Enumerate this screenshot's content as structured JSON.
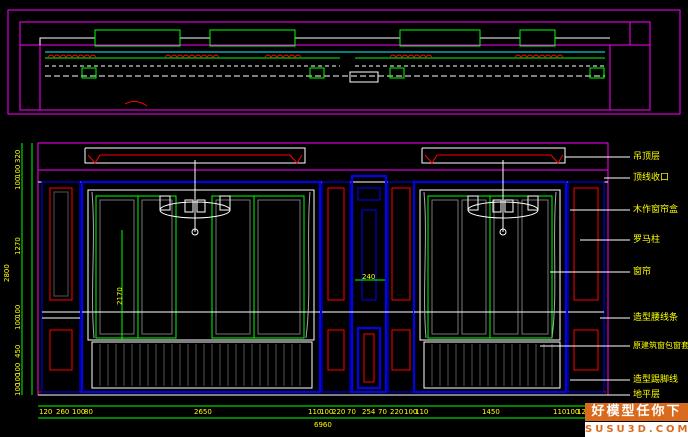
{
  "labels": {
    "ceiling_layer": "吊顶层",
    "ceiling_trim": "顶线收口",
    "wood_curtain_box": "木作窗帘盒",
    "decorative_column": "罗马柱",
    "curtain": "窗帘",
    "shaped_line": "造型腰线条",
    "panel_curtain": "原建筑窗包窗套",
    "skirting_line": "造型踢脚线",
    "floor_level": "地平层"
  },
  "dimensions": {
    "bottom": [
      "120",
      "260",
      "100",
      "80",
      "2650",
      "110",
      "100",
      "220",
      "70",
      "254",
      "70",
      "220",
      "100",
      "110",
      "1450",
      "110",
      "100",
      "120"
    ],
    "overall_width": "6960",
    "left_vertical": [
      "320",
      "100",
      "100",
      "1270",
      "100",
      "100",
      "450",
      "100",
      "100",
      "100"
    ],
    "total_height": "2800",
    "window_height": "2170",
    "column_width": "240"
  },
  "watermark": {
    "line1": "好模型任你下",
    "line2": "SUSU3D.COM"
  },
  "colors": {
    "background": "#000000",
    "frame_magenta": "#ff00ff",
    "green": "#00ff00",
    "blue": "#0000ff",
    "cyan": "#00ffff",
    "yellow": "#ffff00",
    "red": "#ff0000",
    "white": "#ffffff"
  }
}
